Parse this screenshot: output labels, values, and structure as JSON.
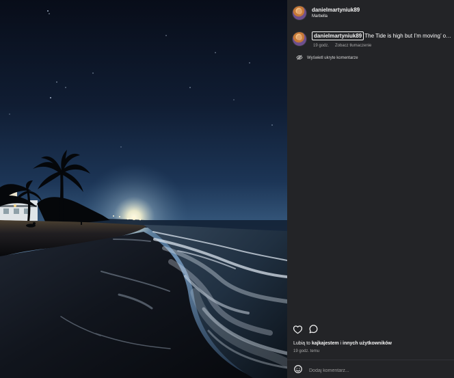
{
  "post": {
    "author": {
      "username": "danielmartyniuk89",
      "location": "Marbella"
    },
    "caption": {
      "username": "danielmartyniuk89",
      "text": "The Tide is high but I’m moving’ on…",
      "time": "19 godz.",
      "translate": "Zobacz tłumaczenie"
    },
    "hidden_comments": {
      "label": "Wyświetl ukryte komentarze",
      "icon": "eye-off-icon"
    },
    "actions": {
      "like_icon": "heart-icon",
      "comment_icon": "comment-bubble-icon"
    },
    "likes": {
      "prefix": "Lubią to",
      "user": "kajkajestem",
      "middle": "i",
      "others": "innych użytkowników"
    },
    "posted": "19 godz. temu",
    "comment_box": {
      "placeholder": "Dodaj komentarz...",
      "emoji_icon": "emoji-icon"
    }
  },
  "colors": {
    "panel_background": "#232427",
    "text_primary": "#f7f7f7",
    "text_secondary": "#a8a8a8"
  }
}
